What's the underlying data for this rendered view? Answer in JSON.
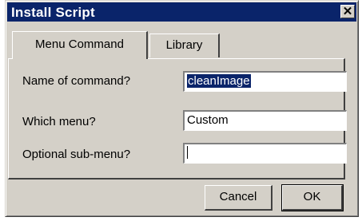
{
  "window": {
    "title": "Install Script",
    "close_glyph": "✕"
  },
  "tabs": [
    {
      "label": "Menu Command",
      "active": true
    },
    {
      "label": "Library",
      "active": false
    }
  ],
  "form": {
    "command_name_label": "Name of command?",
    "command_name_value": "cleanImage",
    "menu_label": "Which menu?",
    "menu_value": "Custom",
    "submenu_label": "Optional sub-menu?",
    "submenu_value": ""
  },
  "buttons": {
    "cancel_label": "Cancel",
    "ok_label": "OK"
  },
  "colors": {
    "title_bar": "#0a246a",
    "dialog_face": "#d4d0c8",
    "selection": "#0a246a"
  }
}
